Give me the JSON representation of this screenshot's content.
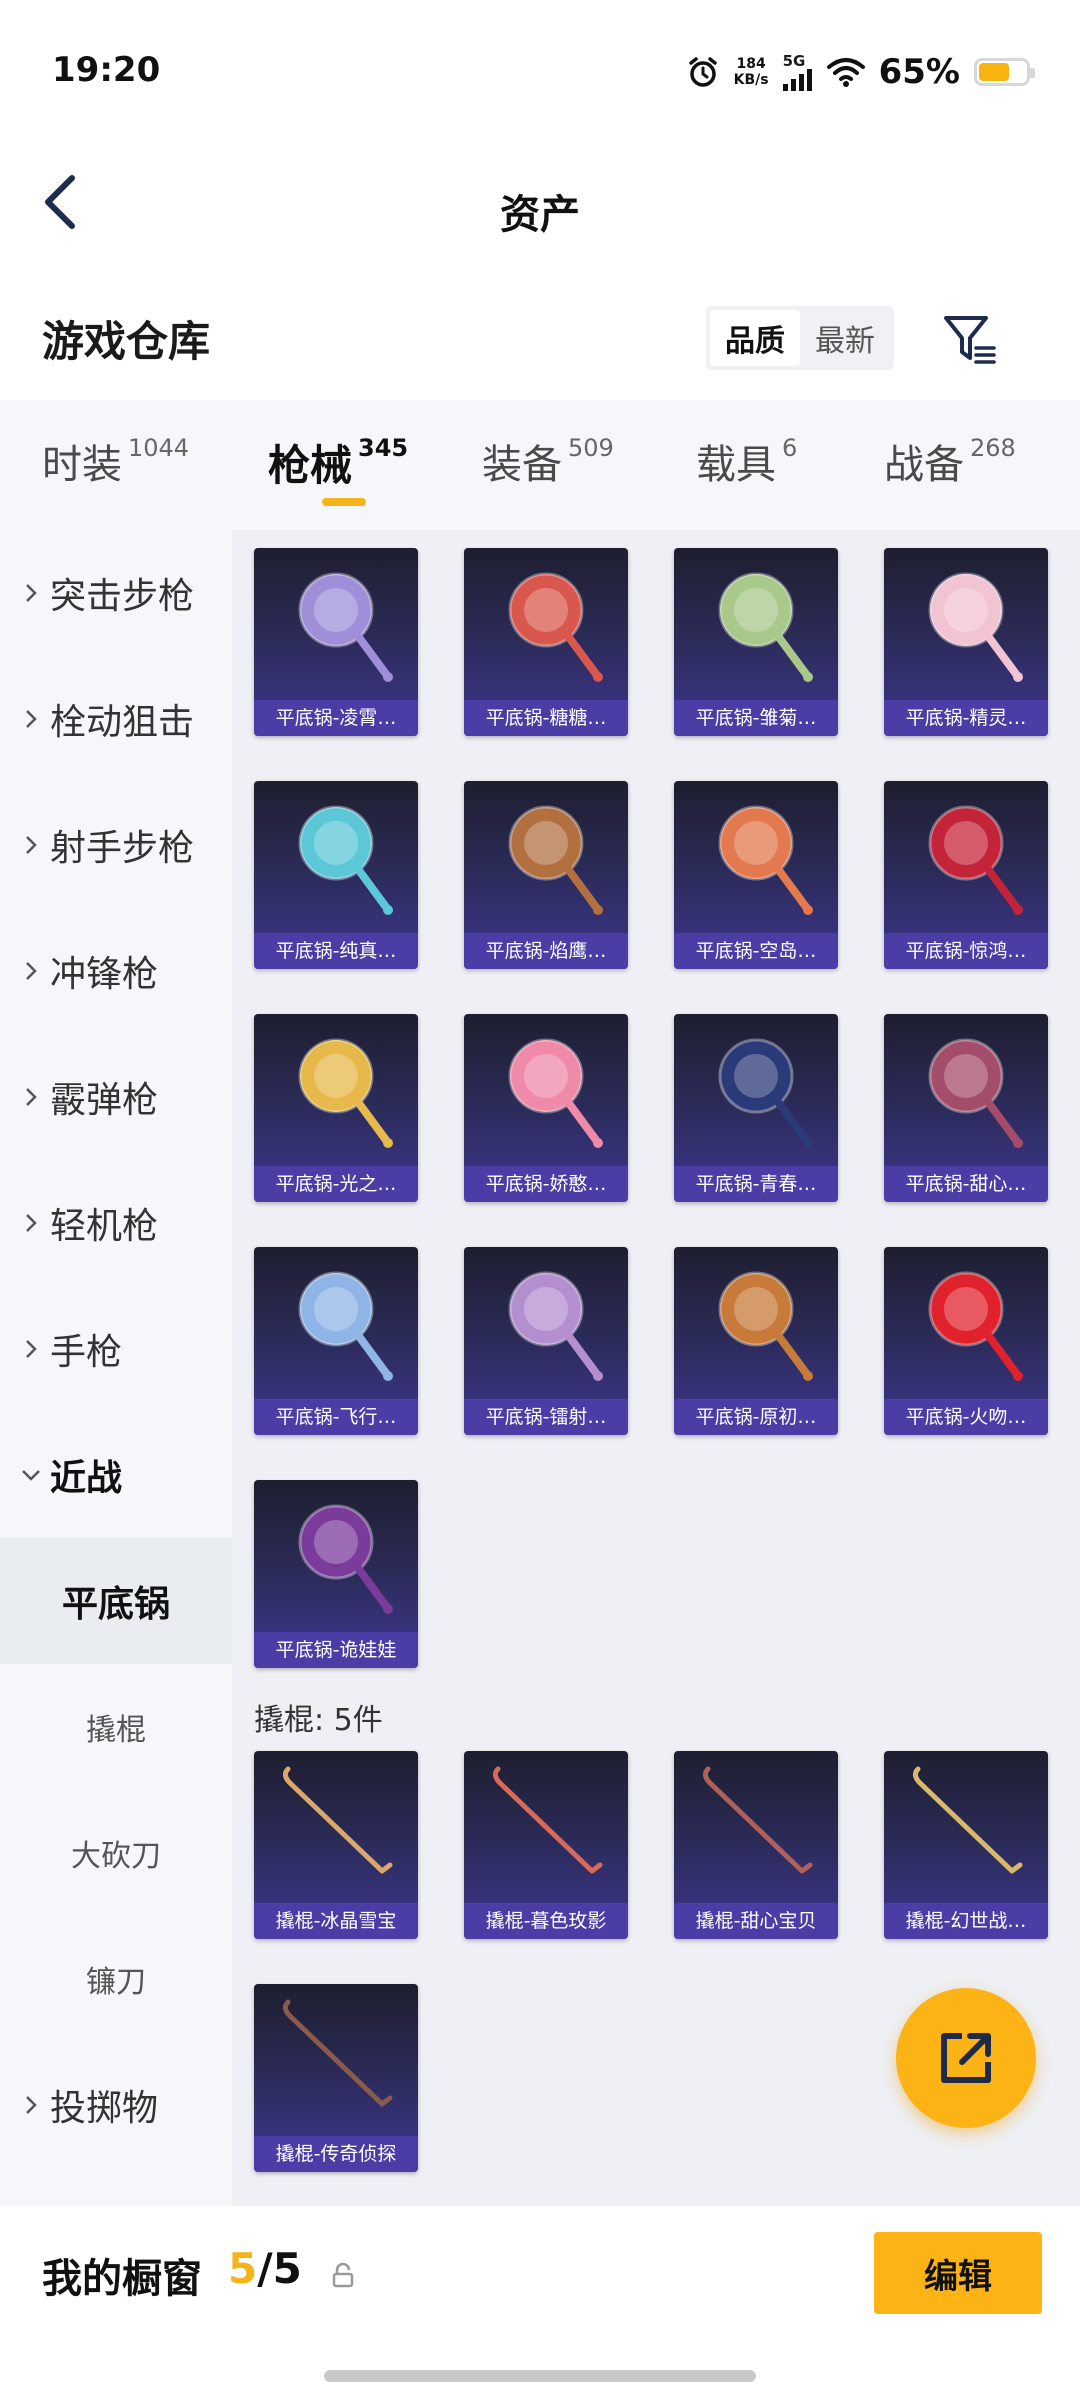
{
  "status_bar": {
    "time": "19:20",
    "net_speed_value": "184",
    "net_speed_unit": "KB/s",
    "network": "5G",
    "battery_pct": "65%",
    "battery_level": 0.65,
    "icons": [
      "alarm-icon",
      "signal-icon",
      "wifi-icon",
      "battery-icon"
    ]
  },
  "nav": {
    "title": "资产"
  },
  "section": {
    "title": "游戏仓库",
    "sort_options": [
      "品质",
      "最新"
    ],
    "sort_active": "品质"
  },
  "tabs": [
    {
      "label": "时装",
      "count": "1044"
    },
    {
      "label": "枪械",
      "count": "345",
      "active": true
    },
    {
      "label": "装备",
      "count": "509"
    },
    {
      "label": "载具",
      "count": "6"
    },
    {
      "label": "战备",
      "count": "268"
    }
  ],
  "sidebar": {
    "categories": [
      {
        "label": "突击步枪",
        "expanded": false
      },
      {
        "label": "栓动狙击",
        "expanded": false
      },
      {
        "label": "射手步枪",
        "expanded": false
      },
      {
        "label": "冲锋枪",
        "expanded": false
      },
      {
        "label": "霰弹枪",
        "expanded": false
      },
      {
        "label": "轻机枪",
        "expanded": false
      },
      {
        "label": "手枪",
        "expanded": false
      },
      {
        "label": "近战",
        "expanded": true
      },
      {
        "label": "投掷物",
        "expanded": false
      }
    ],
    "subcategories": [
      {
        "label": "平底锅",
        "active": true
      },
      {
        "label": "撬棍"
      },
      {
        "label": "大砍刀"
      },
      {
        "label": "镰刀"
      }
    ]
  },
  "pans": [
    {
      "label": "平底锅-凌霄…",
      "color": "#9e8fd8"
    },
    {
      "label": "平底锅-糖糖…",
      "color": "#d9584d"
    },
    {
      "label": "平底锅-雏菊…",
      "color": "#a9c98a"
    },
    {
      "label": "平底锅-精灵…",
      "color": "#f2c3d3"
    },
    {
      "label": "平底锅-纯真…",
      "color": "#5cc7d6"
    },
    {
      "label": "平底锅-焰鹰…",
      "color": "#b27040"
    },
    {
      "label": "平底锅-空岛…",
      "color": "#e2794f"
    },
    {
      "label": "平底锅-惊鸿…",
      "color": "#c4243a"
    },
    {
      "label": "平底锅-光之…",
      "color": "#e6b94a"
    },
    {
      "label": "平底锅-娇憨…",
      "color": "#ef8aa8"
    },
    {
      "label": "平底锅-青春…",
      "color": "#2b3a78"
    },
    {
      "label": "平底锅-甜心…",
      "color": "#a34d6a"
    },
    {
      "label": "平底锅-飞行…",
      "color": "#8fb4e6"
    },
    {
      "label": "平底锅-镭射…",
      "color": "#b48fd0"
    },
    {
      "label": "平底锅-原初…",
      "color": "#c87a3a"
    },
    {
      "label": "平底锅-火吻…",
      "color": "#e0222c"
    },
    {
      "label": "平底锅-诡娃娃",
      "color": "#7a3b9a"
    }
  ],
  "crowbar_group": {
    "header": "撬棍: 5件",
    "items": [
      {
        "label": "撬棍-冰晶雪宝",
        "color": "#d9a86a"
      },
      {
        "label": "撬棍-暮色玫影",
        "color": "#d86a5a"
      },
      {
        "label": "撬棍-甜心宝贝",
        "color": "#b0605a"
      },
      {
        "label": "撬棍-幻世战…",
        "color": "#d8b86a"
      },
      {
        "label": "撬棍-传奇侦探",
        "color": "#8a5a4a"
      }
    ]
  },
  "fab": {
    "icon": "share-icon"
  },
  "bottom_bar": {
    "label": "我的橱窗",
    "current": "5",
    "separator": "/",
    "total": "5",
    "edit_label": "编辑"
  }
}
